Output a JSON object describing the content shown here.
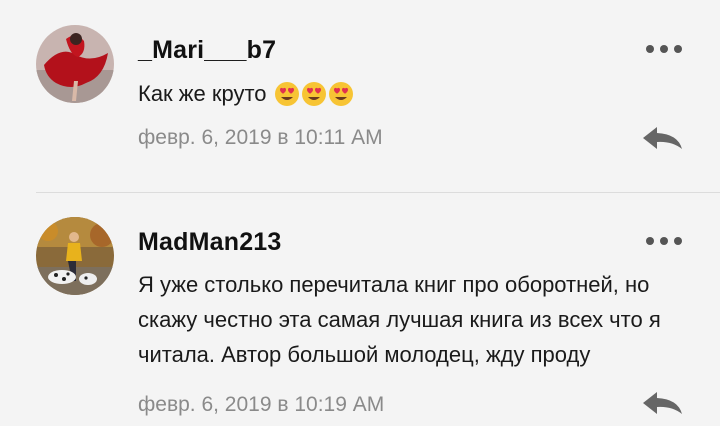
{
  "comments": [
    {
      "username": "_Mari___b7",
      "text": "Как же круто",
      "emojis": [
        "heart-eyes-emoji",
        "heart-eyes-emoji",
        "heart-eyes-emoji"
      ],
      "timestamp": "февр. 6, 2019 в 10:11 AM",
      "avatar": "red-dress-photo"
    },
    {
      "username": "MadMan213",
      "text": "Я уже столько перечитала книг про оборотней, но скажу честно эта самая лучшая книга из всех что я читала. Автор большой молодец, жду проду",
      "timestamp": "февр. 6, 2019 в 10:19 AM",
      "avatar": "autumn-dog-photo"
    }
  ],
  "icons": {
    "more": "more-dots-icon",
    "reply": "reply-arrow-icon"
  },
  "colors": {
    "background": "#f4f4f4",
    "username": "#111111",
    "timestamp": "#8a8a8a",
    "icon": "#555555"
  }
}
